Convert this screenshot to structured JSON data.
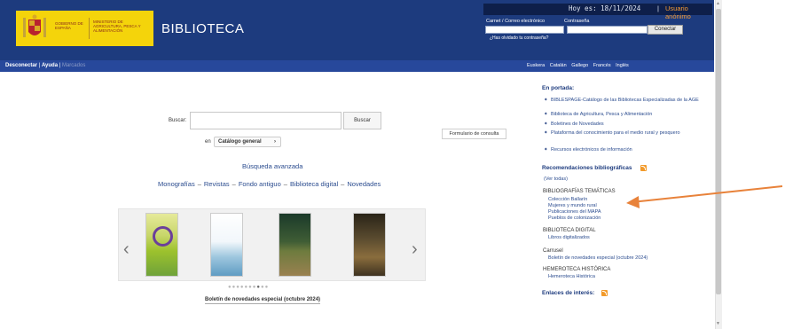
{
  "header": {
    "logo": {
      "gobierno_text": "GOBIERNO DE ESPAÑA",
      "ministerio_text": "MINISTERIO DE AGRICULTURA, PESCA Y ALIMENTACIÓN"
    },
    "site_title": "BIBLIOTECA",
    "date_label": "Hoy es: 18/11/2024",
    "separator": "|",
    "user_status": "Usuario anónimo",
    "login": {
      "card_label": "Carnet / Correo electrónico",
      "password_label": "Contraseña",
      "card_value": "",
      "password_value": "",
      "connect_button": "Conectar",
      "forgot_link": "¿Has olvidado tu contraseña?"
    }
  },
  "navbar": {
    "disconnect": "Desconectar",
    "sep": "|",
    "help": "Ayuda",
    "bookmarks": "Marcados",
    "languages": [
      "Euskera",
      "Catalán",
      "Gallego",
      "Francés",
      "Inglés"
    ]
  },
  "search": {
    "label": "Buscar:",
    "input_value": "",
    "button": "Buscar",
    "scope_label": "en",
    "scope_value": "Catálogo general",
    "scope_chevron": "›",
    "form_link": "Formulario de consulta",
    "advanced": "Búsqueda avanzada"
  },
  "quicklinks": [
    "Monografías",
    "Revistas",
    "Fondo antiguo",
    "Biblioteca digital",
    "Novedades"
  ],
  "quicklinks_sep": "–",
  "carousel": {
    "prev": "‹",
    "next": "›",
    "caption": "Boletín de novedades especial (octubre 2024)",
    "active_dot": 7,
    "dot_count": 10
  },
  "sidebar": {
    "portada_title": "En portada:",
    "portada_items": [
      "BIBLESPAGE-Catálogo de las Bibliotecas Especializadas de la AGE",
      "Biblioteca de Agricultura, Pesca y Alimentación",
      "Boletines de Novedades",
      "Plataforma del conocimiento para el medio rural y pesquero",
      "Recursos electrónicos de información"
    ],
    "recom_title": "Recomendaciones bibliográficas",
    "ver_todas": "(Ver todas)",
    "tematicas_title": "BIBLIOGRAFÍAS TEMÁTICAS",
    "tematicas_items": [
      "Colección Ballarín",
      "Mujeres y mundo rural",
      "Publicaciones del MAPA",
      "Pueblos de colonización"
    ],
    "digital_title": "BIBLIOTECA DIGITAL",
    "digital_items": [
      "Libros digitalizados"
    ],
    "carrusel_title": "Carrusel",
    "carrusel_items": [
      "Boletín de novedades especial (octubre 2024)"
    ],
    "hemeroteca_title": "HEMEROTECA HISTÓRICA",
    "hemeroteca_items": [
      "Hemeroteca Histórica"
    ],
    "enlaces_title": "Enlaces de interés:"
  },
  "colors": {
    "header_bg": "#1d3b7e",
    "navbar_bg": "#27489b",
    "logo_yellow": "#f4d40b",
    "link_blue": "#2b4c8f",
    "accent_orange": "#f59a32",
    "annotation_arrow": "#e8823a"
  }
}
